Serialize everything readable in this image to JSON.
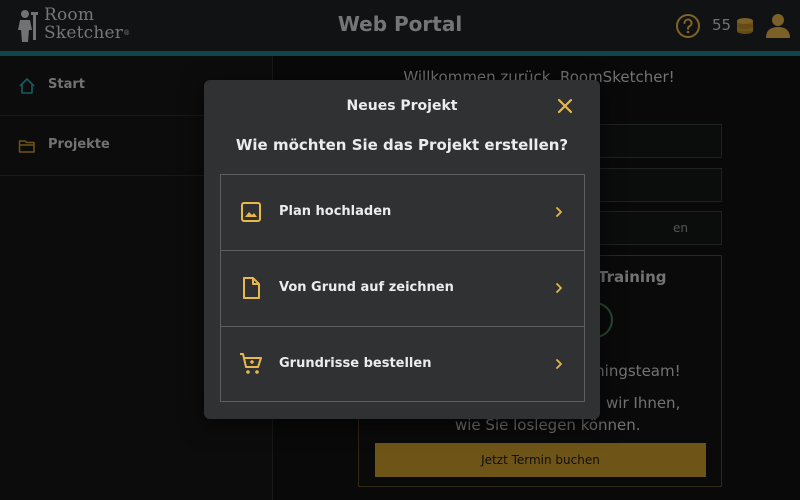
{
  "header": {
    "logo_line1": "Room",
    "logo_line2": "Sketcher",
    "logo_reg": "®",
    "title": "Web Portal",
    "credits": "55"
  },
  "sidebar": {
    "items": [
      {
        "label": "Start",
        "icon": "home-icon"
      },
      {
        "label": "Projekte",
        "icon": "folder-icon"
      }
    ]
  },
  "main": {
    "welcome": "Willkommen zurück, RoomSketcher!",
    "field3_text": "en",
    "training": {
      "title": "Training",
      "line1": "iningsteam!",
      "line2": "gen wir Ihnen,",
      "line3": "wie Sie loslegen können.",
      "button": "Jetzt Termin buchen"
    }
  },
  "modal": {
    "title": "Neues Projekt",
    "question": "Wie möchten Sie das Projekt erstellen?",
    "options": [
      {
        "label": "Plan hochladen",
        "icon": "image-icon"
      },
      {
        "label": "Von Grund auf zeichnen",
        "icon": "document-icon"
      },
      {
        "label": "Grundrisse bestellen",
        "icon": "cart-icon"
      }
    ]
  },
  "colors": {
    "accent": "#e8b84a",
    "teal": "#1e7f86",
    "button": "#c99a2a",
    "modal_bg": "#2f3133"
  }
}
